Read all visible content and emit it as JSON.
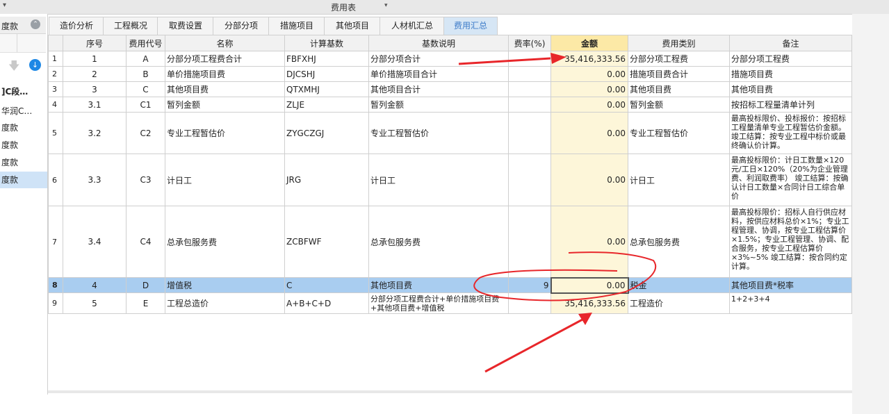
{
  "window": {
    "title": "费用表"
  },
  "left_panel": {
    "header": "度款",
    "items": [
      {
        "label": "]C段…",
        "bold": true,
        "selected": false
      },
      {
        "label": "华润C…",
        "bold": false,
        "selected": false
      },
      {
        "label": "度款",
        "bold": false,
        "selected": false
      },
      {
        "label": "度款",
        "bold": false,
        "selected": false
      },
      {
        "label": "度款",
        "bold": false,
        "selected": false
      },
      {
        "label": "度款",
        "bold": false,
        "selected": true
      }
    ]
  },
  "tabs": [
    {
      "label": "造价分析",
      "active": false
    },
    {
      "label": "工程概况",
      "active": false
    },
    {
      "label": "取费设置",
      "active": false
    },
    {
      "label": "分部分项",
      "active": false
    },
    {
      "label": "措施项目",
      "active": false
    },
    {
      "label": "其他项目",
      "active": false
    },
    {
      "label": "人材机汇总",
      "active": false
    },
    {
      "label": "费用汇总",
      "active": true
    }
  ],
  "table": {
    "columns": [
      "",
      "序号",
      "费用代号",
      "名称",
      "计算基数",
      "基数说明",
      "费率(%)",
      "金额",
      "费用类别",
      "备注"
    ],
    "rows": [
      {
        "num": "1",
        "seq": "1",
        "code": "A",
        "name": "分部分项工程费合计",
        "base": "FBFXHJ",
        "base_desc": "分部分项合计",
        "rate": "",
        "amount": "35,416,333.56",
        "category": "分部分项工程费",
        "note": "分部分项工程费"
      },
      {
        "num": "2",
        "seq": "2",
        "code": "B",
        "name": "单价措施项目费",
        "base": "DJCSHJ",
        "base_desc": "单价措施项目合计",
        "rate": "",
        "amount": "0.00",
        "category": "措施项目费合计",
        "note": "措施项目费"
      },
      {
        "num": "3",
        "seq": "3",
        "code": "C",
        "name": "其他项目费",
        "base": "QTXMHJ",
        "base_desc": "其他项目合计",
        "rate": "",
        "amount": "0.00",
        "category": "其他项目费",
        "note": "其他项目费"
      },
      {
        "num": "4",
        "seq": "3.1",
        "code": "C1",
        "name": "暂列金额",
        "base": "ZLJE",
        "base_desc": "暂列金额",
        "rate": "",
        "amount": "0.00",
        "category": "暂列金额",
        "note": "按招标工程量清单计列"
      },
      {
        "num": "5",
        "seq": "3.2",
        "code": "C2",
        "name": "专业工程暂估价",
        "base": "ZYGCZGJ",
        "base_desc": "专业工程暂估价",
        "rate": "",
        "amount": "0.00",
        "category": "专业工程暂估价",
        "note": "最高投标限价、投标报价：按招标工程量清单专业工程暂估价金额。 竣工结算：按专业工程中标价或最终确认价计算。"
      },
      {
        "num": "6",
        "seq": "3.3",
        "code": "C3",
        "name": "计日工",
        "base": "JRG",
        "base_desc": "计日工",
        "rate": "",
        "amount": "0.00",
        "category": "计日工",
        "note": "最高投标限价：计日工数量×120元/工日×120%（20%为企业管理费、利润取费率） 竣工结算：按确认计日工数量×合同计日工综合单价"
      },
      {
        "num": "7",
        "seq": "3.4",
        "code": "C4",
        "name": "总承包服务费",
        "base": "ZCBFWF",
        "base_desc": "总承包服务费",
        "rate": "",
        "amount": "0.00",
        "category": "总承包服务费",
        "note": "最高投标限价：招标人自行供应材料，按供应材料总价×1%；专业工程管理、协调，按专业工程估算价×1.5%；专业工程管理、协调、配合服务，按专业工程估算价×3%~5% 竣工结算：按合同约定计算。"
      },
      {
        "num": "8",
        "seq": "4",
        "code": "D",
        "name": "增值税",
        "base": "C",
        "base_desc": "其他项目费",
        "rate": "9",
        "amount": "0.00",
        "category": "税金",
        "note": "其他项目费*税率"
      },
      {
        "num": "9",
        "seq": "5",
        "code": "E",
        "name": "工程总造价",
        "base": "A+B+C+D",
        "base_desc": "分部分项工程费合计+单价措施项目费+其他项目费+增值税",
        "rate": "",
        "amount": "35,416,333.56",
        "category": "工程造价",
        "note": "1+2+3+4"
      }
    ],
    "selected_row": "8"
  },
  "colors": {
    "accent": "#3d7cc9",
    "selected_row": "#a9cdf0",
    "amount_header": "#fce9a6",
    "annotation": "#e8262a"
  }
}
